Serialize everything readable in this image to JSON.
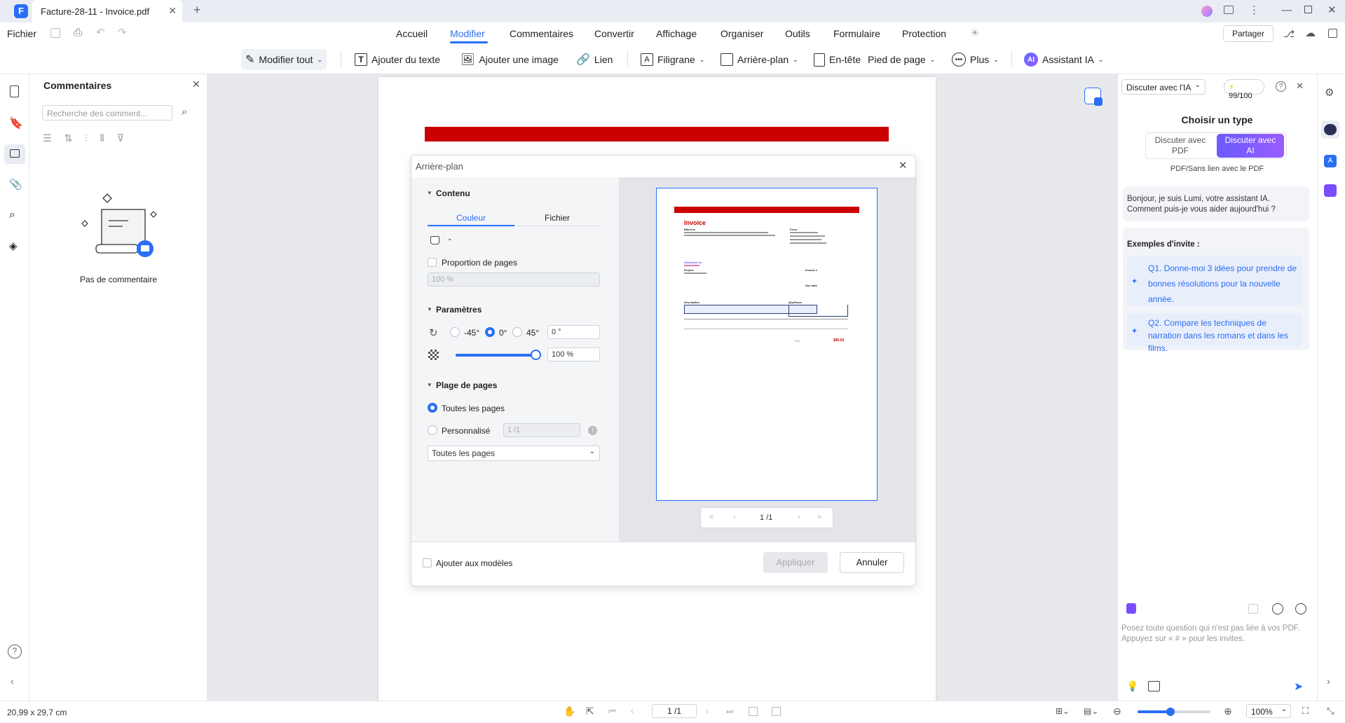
{
  "titlebar": {
    "tab_title": "Facture-28-11 - Invoice.pdf",
    "logo": "F"
  },
  "menubar": {
    "file": "Fichier",
    "items": [
      "Accueil",
      "Modifier",
      "Commentaires",
      "Convertir",
      "Affichage",
      "Organiser",
      "Outils",
      "Formulaire",
      "Protection"
    ],
    "active": "Modifier",
    "share": "Partager"
  },
  "toolbar": {
    "edit_all": "Modifier tout",
    "add_text": "Ajouter du texte",
    "add_image": "Ajouter une image",
    "link": "Lien",
    "watermark": "Filigrane",
    "background": "Arrière-plan",
    "header": "En-tête",
    "footer": "Pied de page",
    "more": "Plus",
    "ai_assistant": "Assistant IA",
    "ai_badge": "AI"
  },
  "comments_panel": {
    "title": "Commentaires",
    "search_placeholder": "Recherche des comment...",
    "empty_text": "Pas de commentaire"
  },
  "dialog": {
    "title": "Arrière-plan",
    "content_section": "Contenu",
    "tabs": [
      "Couleur",
      "Fichier"
    ],
    "page_proportion": "Proportion de pages",
    "proportion_value": "100 %",
    "params_section": "Paramètres",
    "angles": [
      "-45°",
      "0°",
      "45°"
    ],
    "angle_value": "0 °",
    "opacity_value": "100 %",
    "opacity_level": 1.0,
    "range_section": "Plage de pages",
    "all_pages": "Toutes les pages",
    "custom": "Personnalisé",
    "custom_value": "1 /1",
    "range_select": "Toutes les pages",
    "add_to_templates": "Ajouter aux modèles",
    "apply": "Appliquer",
    "cancel": "Annuler",
    "pager": "1 /1"
  },
  "preview": {
    "invoice_title": "Invoice",
    "billed_to": "Billed to",
    "from": "From",
    "submitted_on": "Submitted on",
    "project": "Project",
    "invoice_no": "Invoice #",
    "due_date": "Due date",
    "description": "Description",
    "qty": "Qty/Hours",
    "total_label": "Total",
    "total_value": "$90,03"
  },
  "ai_panel": {
    "mode_select": "Discuter avec l'IA",
    "credits": "99/100",
    "choose_type": "Choisir un type",
    "opt_pdf": "Discuter avec PDF",
    "opt_ai": "Discuter avec AI",
    "subtitle": "PDF/Sans lien avec le PDF",
    "greeting": "Bonjour, je suis Lumi, votre assistant IA. Comment puis-je vous aider aujourd'hui ?",
    "examples_title": "Exemples d'invite :",
    "examples": [
      "Q1. Donne-moi 3 idées pour prendre de bonnes résolutions pour la nouvelle année.",
      "Q2. Compare les techniques de narration dans les romans et dans les films."
    ],
    "input_placeholder": "Posez toute question qui n'est pas liée à vos PDF. Appuyez sur « # » pour les invites."
  },
  "statusbar": {
    "page_size": "20,99 x 29,7 cm",
    "page_indicator": "1 /1",
    "zoom": "100%",
    "zoom_level": 0.45
  },
  "colors": {
    "accent": "#2a6ef5",
    "invoice_red": "#cc0000",
    "ai_purple": "#7a4dff"
  }
}
